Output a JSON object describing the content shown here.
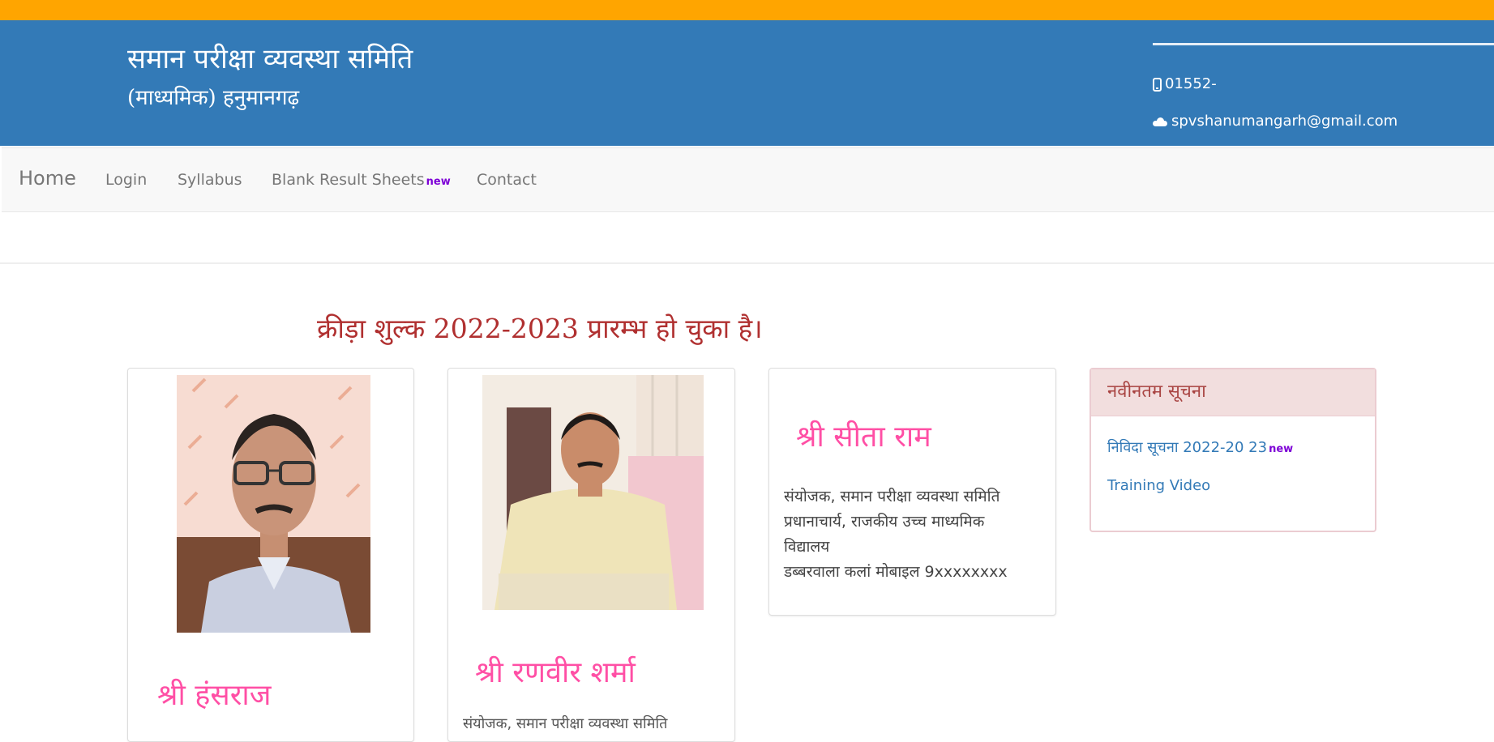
{
  "header": {
    "title": "समान परीक्षा व्यवस्था समिति",
    "subtitle": "(माध्यमिक) हनुमानगढ़",
    "phone": "01552-",
    "email": "spvshanumangarh@gmail.com",
    "phone_icon": "mobile-phone-icon",
    "email_icon": "cloud-icon"
  },
  "nav": {
    "brand": "Home",
    "items": [
      "Login",
      "Syllabus",
      "Blank Result Sheets",
      "Contact"
    ],
    "new_badge": "new"
  },
  "announcement": "क्रीड़ा शुल्क 2022-2023 प्रारम्भ हो चुका है।",
  "people": [
    {
      "name": "श्री हंसराज",
      "description": []
    },
    {
      "name": "श्री रणवीर शर्मा",
      "description": [
        "संयोजक, समान परीक्षा व्यवस्था समिति"
      ]
    },
    {
      "name": "श्री सीता राम",
      "description": [
        "संयोजक, समान परीक्षा व्यवस्था समिति",
        "प्रधानाचार्य, राजकीय उच्च माध्यमिक",
        "विद्यालय",
        "डब्बरवाला कलां मोबाइल 9xxxxxxxx"
      ]
    }
  ],
  "notice": {
    "heading": "नवीनतम सूचना",
    "links": [
      "निविदा सूचना 2022-20 23",
      "Training Video"
    ],
    "new_badge": "new"
  },
  "colors": {
    "top_strip": "#ffa500",
    "header_bg": "#337ab7",
    "announcement": "#b03030",
    "name_pink": "#ff4fa5",
    "badge_purple": "#7d00d6"
  }
}
